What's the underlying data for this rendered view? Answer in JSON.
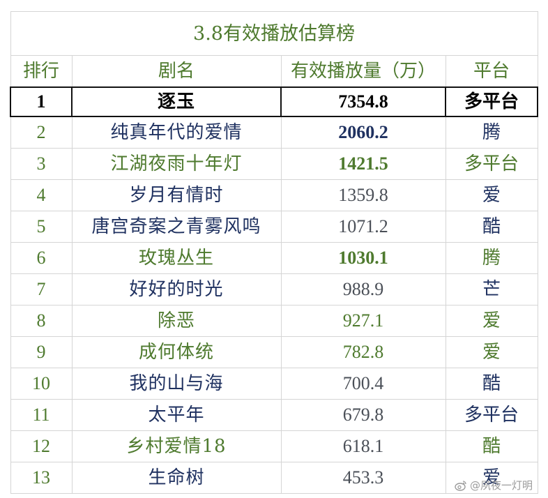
{
  "title": "3.8有效播放估算榜",
  "headers": {
    "rank": "排行",
    "name": "剧名",
    "views": "有效播放量（万）",
    "platform": "平台"
  },
  "rows": [
    {
      "rank": "1",
      "name": "逐玉",
      "views": "7354.8",
      "platform": "多平台"
    },
    {
      "rank": "2",
      "name": "纯真年代的爱情",
      "views": "2060.2",
      "platform": "腾"
    },
    {
      "rank": "3",
      "name": "江湖夜雨十年灯",
      "views": "1421.5",
      "platform": "多平台"
    },
    {
      "rank": "4",
      "name": "岁月有情时",
      "views": "1359.8",
      "platform": "爱"
    },
    {
      "rank": "5",
      "name": "唐宫奇案之青雾风鸣",
      "views": "1071.2",
      "platform": "酷"
    },
    {
      "rank": "6",
      "name": "玫瑰丛生",
      "views": "1030.1",
      "platform": "腾"
    },
    {
      "rank": "7",
      "name": "好好的时光",
      "views": "988.9",
      "platform": "芒"
    },
    {
      "rank": "8",
      "name": "除恶",
      "views": "927.1",
      "platform": "爱"
    },
    {
      "rank": "9",
      "name": "成何体统",
      "views": "782.8",
      "platform": "爱"
    },
    {
      "rank": "10",
      "name": "我的山与海",
      "views": "700.4",
      "platform": "酷"
    },
    {
      "rank": "11",
      "name": "太平年",
      "views": "679.8",
      "platform": "多平台"
    },
    {
      "rank": "12",
      "name": "乡村爱情18",
      "views": "618.1",
      "platform": "酷"
    },
    {
      "rank": "13",
      "name": "生命树",
      "views": "453.3",
      "platform": "爱"
    }
  ],
  "watermark": {
    "text": "@夙夜一灯明",
    "icon": "weibo-icon"
  },
  "colors": {
    "green": "#4e7a2e",
    "navy": "#1f3160",
    "gray": "#4a4f57",
    "black": "#000000",
    "grid": "#d5d5d5"
  }
}
